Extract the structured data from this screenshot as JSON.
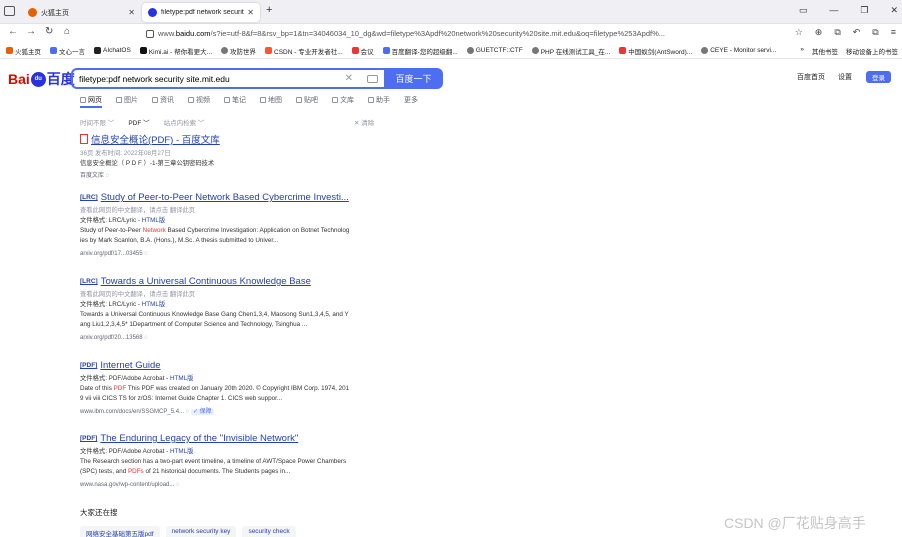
{
  "browser": {
    "tabs": [
      {
        "title": "火狐主页",
        "close": "✕"
      },
      {
        "title": "filetype:pdf network security",
        "close": "✕"
      }
    ],
    "new_tab": "+",
    "url_prefix": "www.",
    "url_host": "baidu.com",
    "url_rest": "/s?ie=utf-8&f=8&rsv_bp=1&tn=34046034_10_dg&wd=filetype%3Apdf%20network%20security%20site.mit.edu&oq=filetype%253Apdf%...",
    "window_controls": [
      "▭",
      "—",
      "❐",
      "✕"
    ],
    "nav": {
      "back": "←",
      "forward": "→",
      "reload": "↻",
      "home": "⌂"
    },
    "nav_right": [
      "☆",
      "⊕",
      "⧉",
      "↶",
      "⧉",
      "≡"
    ],
    "bookmarks": [
      {
        "label": "火狐主页",
        "color": "#e66000"
      },
      {
        "label": "文心一言",
        "color": "#4e6ef2"
      },
      {
        "label": "AIchatOS",
        "color": "#222222"
      },
      {
        "label": "Kimi.ai - 帮你看更大...",
        "color": "#111111"
      },
      {
        "label": "攻防世界",
        "color": "#777777"
      },
      {
        "label": "CSDN - 专业开发者社...",
        "color": "#fc5531"
      },
      {
        "label": "会议",
        "color": "#e33333"
      },
      {
        "label": "百度翻译-您的超级翻...",
        "color": "#4e6ef2"
      },
      {
        "label": "GUETCTF::CTF",
        "color": "#777777"
      },
      {
        "label": "PHP 在线测试工具_在...",
        "color": "#777777"
      },
      {
        "label": "中国蚁剑(AntSword)...",
        "color": "#e33333"
      },
      {
        "label": "CEYE - Monitor servi...",
        "color": "#777777"
      }
    ],
    "bookmarks_right": [
      "»",
      "其他书签",
      "移动设备上的书签"
    ]
  },
  "baidu": {
    "logo_left": "Bai",
    "logo_paw": "du",
    "logo_right": "百度",
    "query": "filetype:pdf network security site.mit.edu",
    "clear": "✕",
    "search_button": "百度一下",
    "top_links": [
      "百度首页",
      "设置"
    ],
    "login": "登录",
    "tabs": [
      "网页",
      "图片",
      "资讯",
      "视频",
      "笔记",
      "地图",
      "贴吧",
      "文库",
      "助手",
      "更多"
    ],
    "filters": [
      "时间不限",
      "PDF",
      "站点内检索"
    ],
    "clear_filters": "清除"
  },
  "results": [
    {
      "badge": "",
      "title": "信息安全概论(PDF) - 百度文库",
      "meta": "36页 发布时间: 2022年08月27日",
      "line1": "信息安全概论（ P D F ）-1-第三章公钥密码技术",
      "source": "百度文库"
    },
    {
      "badge": "[LRC]",
      "title": "Study of Peer-to-Peer Network Based Cybercrime Investi...",
      "meta": "查看此网页的中文翻译，请点击 翻译此页",
      "format_label": "文件格式:  LRC/Lyric - ",
      "format_link": "HTML版",
      "line1_pre": "Study of Peer-to-Peer ",
      "line1_hl": "Network",
      "line1_post": " Based Cybercrime Investigation: Application on Botnet Technolog",
      "line2": "ies by Mark Scanlon, B.A. (Hons.), M.Sc. A thesis submitted to Univer...",
      "source": "arxiv.org/pdf/17...03455"
    },
    {
      "badge": "[LRC]",
      "title": "Towards a Universal Continuous Knowledge Base",
      "meta": "查看此网页的中文翻译，请点击 翻译此页",
      "format_label": "文件格式:  LRC/Lyric - ",
      "format_link": "HTML版",
      "line1": "Towards a Universal Continuous Knowledge Base Gang Chen1,3,4, Maosong Sun1,3,4,5, and Y",
      "line2": "ang Liu1,2,3,4,5* 1Department of Computer Science and Technology, Tsinghua ...",
      "source": "arxiv.org/pdf/20...13568"
    },
    {
      "badge": "[PDF]",
      "title": "Internet Guide",
      "format_label": "文件格式:  PDF/Adobe Acrobat - ",
      "format_link": "HTML版",
      "line1_pre": "Date of this ",
      "line1_hl": "PDF",
      "line1_post": " This PDF was created on January 20th 2020. © Copyright IBM Corp. 1974, 201",
      "line2": "9 vii viii CICS TS for z/OS: Internet Guide Chapter 1. CICS web suppor...",
      "source": "www.ibm.com/docs/en/SSGMCP_5.4...",
      "verified": "保障"
    },
    {
      "badge": "[PDF]",
      "title": "The Enduring Legacy of the \"Invisible Network\"",
      "format_label": "文件格式:  PDF/Adobe Acrobat - ",
      "format_link": "HTML版",
      "line1": "The Research section has a two-part event timeline, a timeline of AWT/Space Power Chambers",
      "line2_pre": "(SPC) tests, and ",
      "line2_hl": "PDFs",
      "line2_post": " of 21 historical documents. The Students pages in...",
      "source": "www.nasa.gov/wp-content/upload..."
    }
  ],
  "related_title": "大家还在搜",
  "related": [
    "网络安全基础第五版pdf",
    "network security key",
    "security check"
  ],
  "watermark": "CSDN @厂花贴身高手"
}
